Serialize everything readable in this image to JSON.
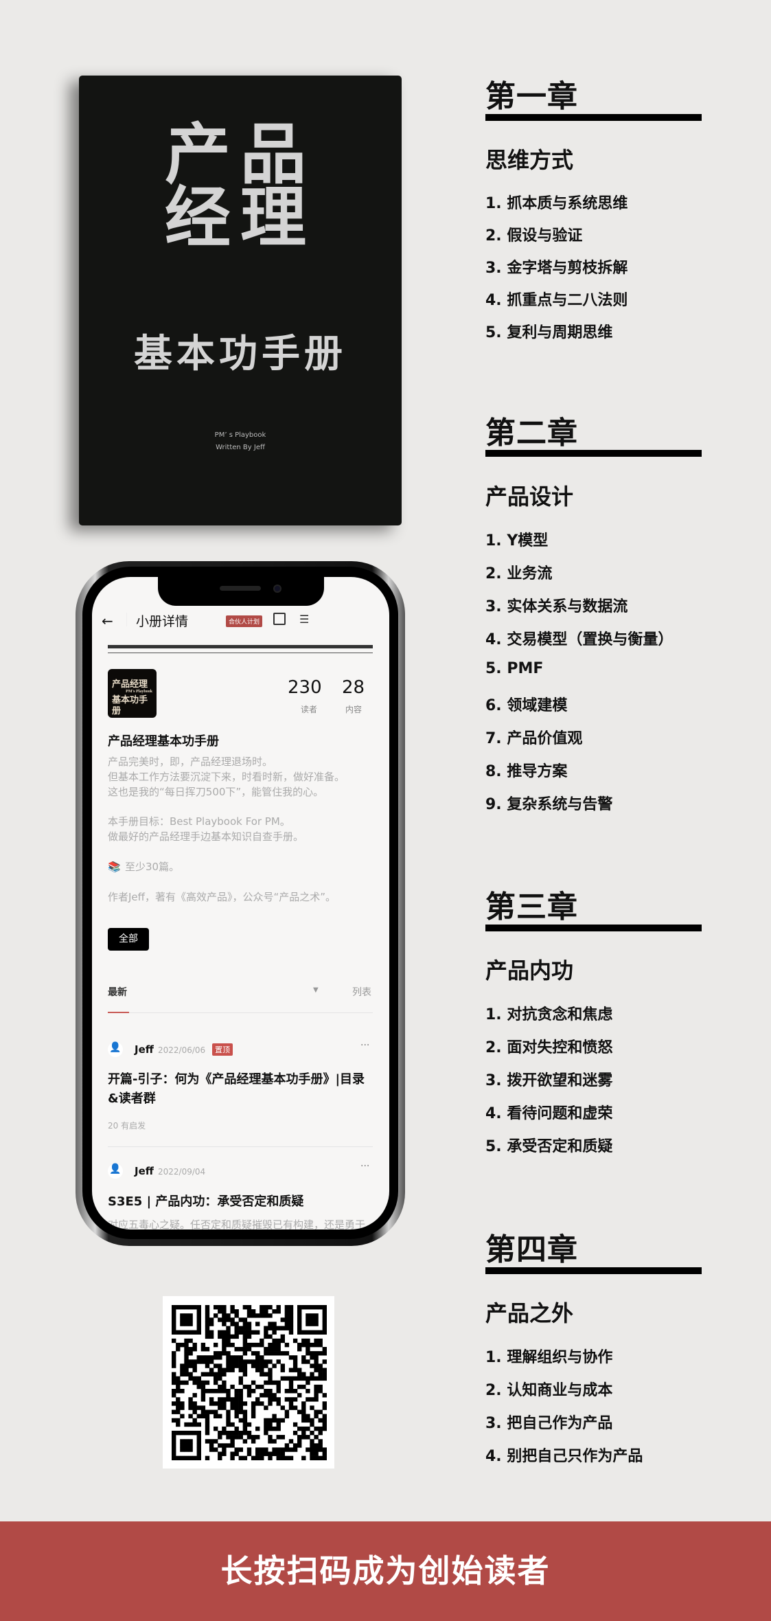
{
  "cover": {
    "line1": "产品",
    "line2": "经理",
    "line3": "基本功手册",
    "sub1": "PM’ s Playbook",
    "sub2": "Written By Jeff"
  },
  "app": {
    "nav_title": "小册详情",
    "partner_badge": "合伙人计划",
    "thumb_text1": "产品经理",
    "thumb_text2": "PM's Playbook",
    "thumb_text3": "基本功手册",
    "stats": [
      {
        "value": "230",
        "label": "读者"
      },
      {
        "value": "28",
        "label": "内容"
      }
    ],
    "book_title": "产品经理基本功手册",
    "desc": [
      "产品完美时，即，产品经理退场时。",
      "但基本工作方法要沉淀下来，时看时新，做好准备。",
      "这也是我的“每日挥刀500下”，能管住我的心。",
      "本手册目标：Best Playbook For PM。",
      "做最好的产品经理手边基本知识自查手册。",
      "至少30篇。",
      "作者Jeff，著有《高效产品》，公众号“产品之术”。"
    ],
    "filter_all": "全部",
    "sort_latest": "最新",
    "view_list": "列表",
    "posts": [
      {
        "author": "Jeff",
        "date": "2022/06/06",
        "badge": "置顶",
        "title": "开篇-引子：何为《产品经理基本功手册》|目录&读者群",
        "meta": "20 有启发"
      },
      {
        "author": "Jeff",
        "date": "2022/09/04",
        "title": "S3E5 | 产品内功：承受否定和质疑",
        "excerpt": "对应五毒心之疑。任否定和质疑摧毁已有构建，还是勇于"
      }
    ]
  },
  "chapters": [
    {
      "heading": "第一章",
      "subtitle": "思维方式",
      "items": [
        "1. 抓本质与系统思维",
        "2. 假设与验证",
        "3. 金字塔与剪枝拆解",
        "4. 抓重点与二八法则",
        "5. 复利与周期思维"
      ]
    },
    {
      "heading": "第二章",
      "subtitle": "产品设计",
      "items": [
        "1. Y模型",
        "2. 业务流",
        "3. 实体关系与数据流",
        "4. 交易模型（置换与衡量）",
        "5. PMF",
        "6. 领域建模",
        "7. 产品价值观",
        "8. 推导方案",
        "9. 复杂系统与告警"
      ]
    },
    {
      "heading": "第三章",
      "subtitle": "产品内功",
      "items": [
        "1. 对抗贪念和焦虑",
        "2. 面对失控和愤怒",
        "3. 拨开欲望和迷雾",
        "4. 看待问题和虚荣",
        "5. 承受否定和质疑"
      ]
    },
    {
      "heading": "第四章",
      "subtitle": "产品之外",
      "items": [
        "1. 理解组织与协作",
        "2. 认知商业与成本",
        "3. 把自己作为产品",
        "4. 别把自己只作为产品"
      ]
    }
  ],
  "banner": "长按扫码成为创始读者",
  "colors": {
    "accent": "#b14a46",
    "background": "#ebeae8",
    "cover": "#131412"
  }
}
